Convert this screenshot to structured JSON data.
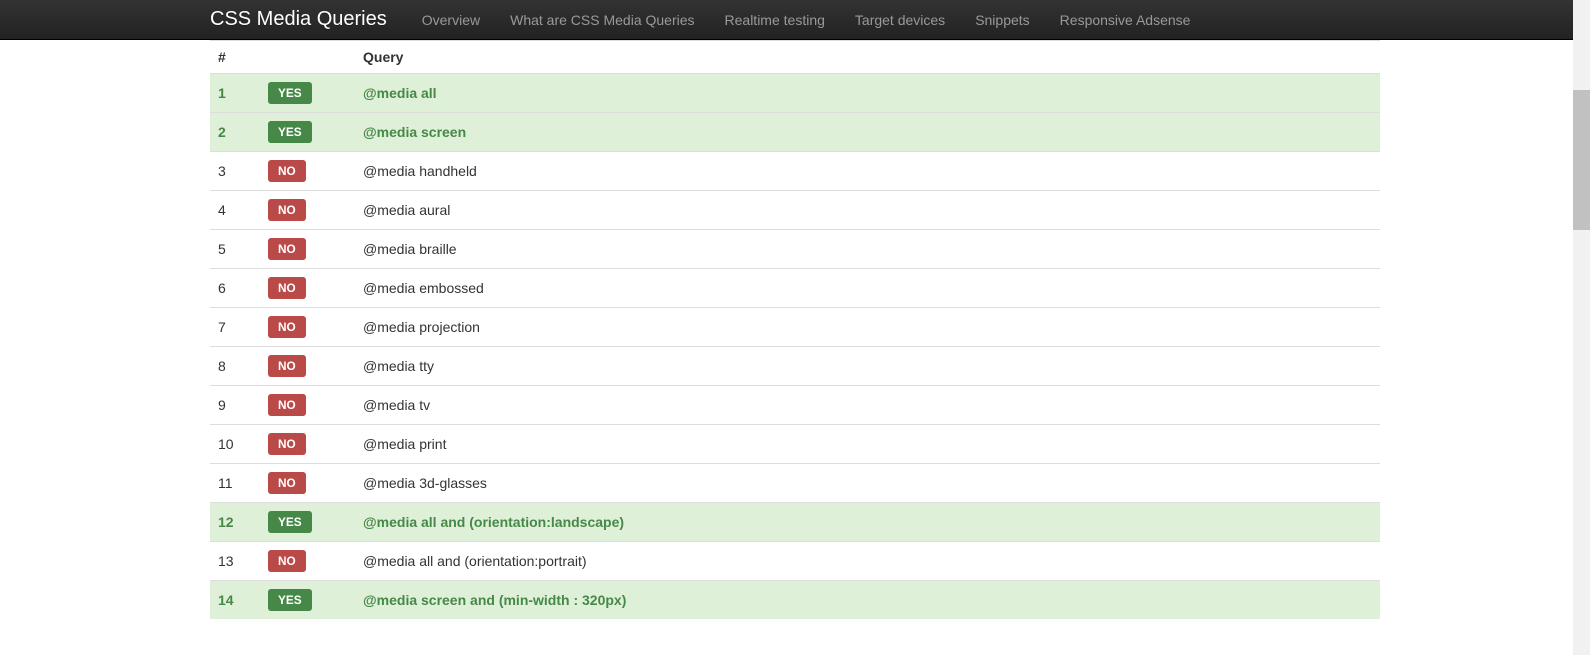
{
  "navbar": {
    "brand": "CSS Media Queries",
    "links": [
      "Overview",
      "What are CSS Media Queries",
      "Realtime testing",
      "Target devices",
      "Snippets",
      "Responsive Adsense"
    ]
  },
  "table": {
    "headers": {
      "num": "#",
      "query": "Query"
    },
    "rows": [
      {
        "num": "1",
        "status": "YES",
        "query": "@media all"
      },
      {
        "num": "2",
        "status": "YES",
        "query": "@media screen"
      },
      {
        "num": "3",
        "status": "NO",
        "query": "@media handheld"
      },
      {
        "num": "4",
        "status": "NO",
        "query": "@media aural"
      },
      {
        "num": "5",
        "status": "NO",
        "query": "@media braille"
      },
      {
        "num": "6",
        "status": "NO",
        "query": "@media embossed"
      },
      {
        "num": "7",
        "status": "NO",
        "query": "@media projection"
      },
      {
        "num": "8",
        "status": "NO",
        "query": "@media tty"
      },
      {
        "num": "9",
        "status": "NO",
        "query": "@media tv"
      },
      {
        "num": "10",
        "status": "NO",
        "query": "@media print"
      },
      {
        "num": "11",
        "status": "NO",
        "query": "@media 3d-glasses"
      },
      {
        "num": "12",
        "status": "YES",
        "query": "@media all and (orientation:landscape)"
      },
      {
        "num": "13",
        "status": "NO",
        "query": "@media all and (orientation:portrait)"
      },
      {
        "num": "14",
        "status": "YES",
        "query": "@media screen and (min-width : 320px)"
      }
    ]
  }
}
